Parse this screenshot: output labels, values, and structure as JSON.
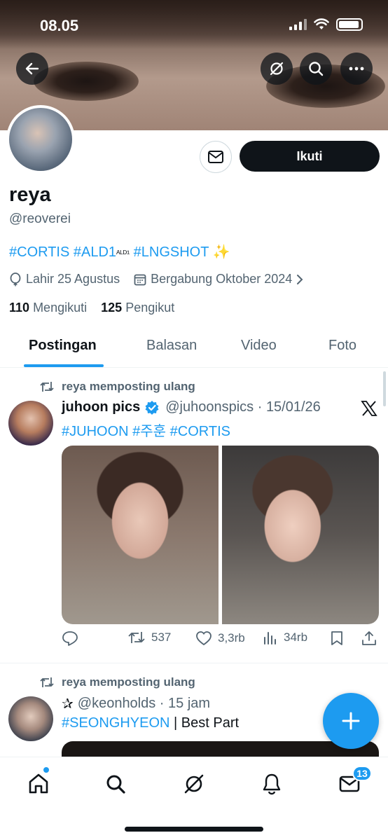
{
  "status_bar": {
    "time": "08.05"
  },
  "profile": {
    "follow_label": "Ikuti",
    "name": "reya",
    "handle": "@reoverei",
    "bio": {
      "tag1": "#CORTIS",
      "tag2": "#ALD1",
      "tag2_suffix": "ᴬᴸᴰ¹",
      "tag3": "#LNGSHOT",
      "emoji": "✨"
    },
    "birthday": "Lahir 25 Agustus",
    "joined": "Bergabung Oktober 2024",
    "following_count": "110",
    "following_label": "Mengikuti",
    "followers_count": "125",
    "followers_label": "Pengikut"
  },
  "tabs": [
    {
      "label": "Postingan",
      "active": true
    },
    {
      "label": "Balasan",
      "active": false
    },
    {
      "label": "Video",
      "active": false
    },
    {
      "label": "Foto",
      "active": false
    }
  ],
  "posts": [
    {
      "repost_label": "reya memposting ulang",
      "author_name": "juhoon pics",
      "verified": true,
      "author_handle": "@juhoonspics",
      "date": "15/01/26",
      "tags": [
        "#JUHOON",
        "#주훈",
        "#CORTIS"
      ],
      "reposts": "537",
      "likes": "3,3rb",
      "views": "34rb"
    },
    {
      "repost_label": "reya memposting ulang",
      "author_name": "✰",
      "author_handle": "@keonholds",
      "date": "15 jam",
      "tag": "#SEONGHYEON",
      "text": "| Best Part"
    }
  ],
  "bottom_nav": {
    "messages_badge": "13"
  },
  "colors": {
    "accent": "#1d9bf0",
    "text": "#0f1419",
    "muted": "#536471"
  }
}
